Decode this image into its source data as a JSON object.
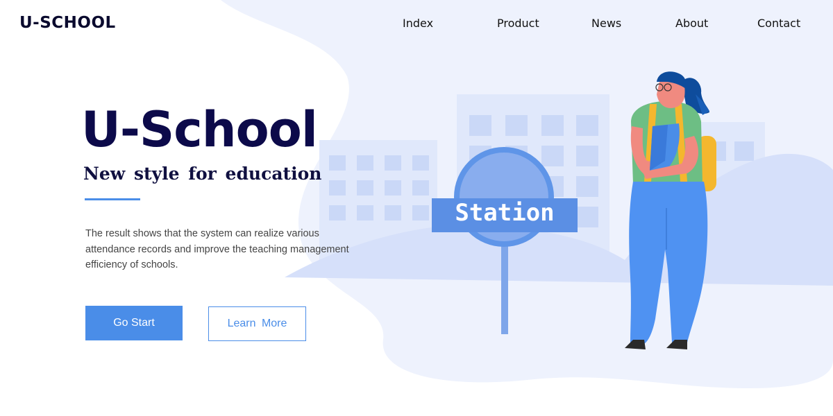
{
  "header": {
    "logo": "U-SCHOOL",
    "nav": [
      {
        "label": "Index"
      },
      {
        "label": "Product"
      },
      {
        "label": "News"
      },
      {
        "label": "About"
      },
      {
        "label": "Contact"
      }
    ]
  },
  "hero": {
    "title": "U-School",
    "subtitle": "New  style  for education",
    "description": "The result shows that the system can realize various attendance records and improve the teaching management efficiency of schools.",
    "primary_button": "Go Start",
    "secondary_button": "Learn  More"
  },
  "illustration": {
    "sign_text": "Station"
  },
  "colors": {
    "accent": "#4a8de8",
    "title": "#0c0a4a",
    "background_blob": "#eef2fd",
    "building": "#dfe7fb"
  }
}
